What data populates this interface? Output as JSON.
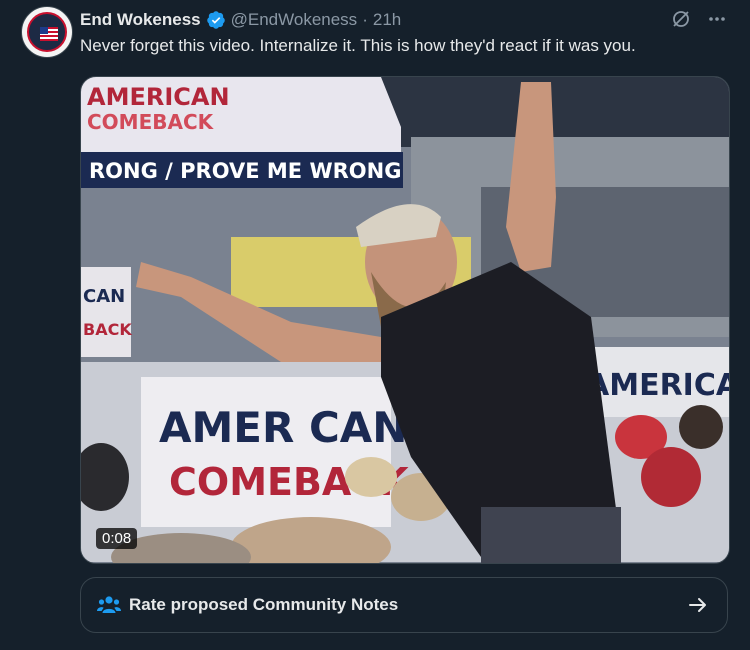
{
  "tweet": {
    "display_name": "End Wokeness",
    "handle": "@EndWokeness",
    "separator": "·",
    "time": "21h",
    "text": "Never forget this video. Internalize it. This is how they'd react if it was you.",
    "verified_color": "#1d9bf0",
    "icons": {
      "verified": "verified-badge-icon",
      "grok": "grok-icon",
      "more": "more-icon"
    }
  },
  "avatar": {
    "text_top": "FUNDPOINT USA",
    "text_bottom": "YOUNG WOKENESS"
  },
  "media": {
    "type": "video",
    "duration": "0:08",
    "banner_text": "RONG / PROVE ME WRONG",
    "sign_left_top": "AMER CAN",
    "sign_left_bottom": "COMEBACK",
    "sign_right": "AMERICAN",
    "tent_top": "AMERICAN",
    "tent_bottom": "COMEBACK",
    "side_sign_top": "CAN",
    "side_sign_bottom": "BACK"
  },
  "community_notes": {
    "label": "Rate proposed Community Notes",
    "icons": {
      "people": "people-icon",
      "arrow": "arrow-right-icon"
    },
    "accent": "#1d9bf0"
  }
}
